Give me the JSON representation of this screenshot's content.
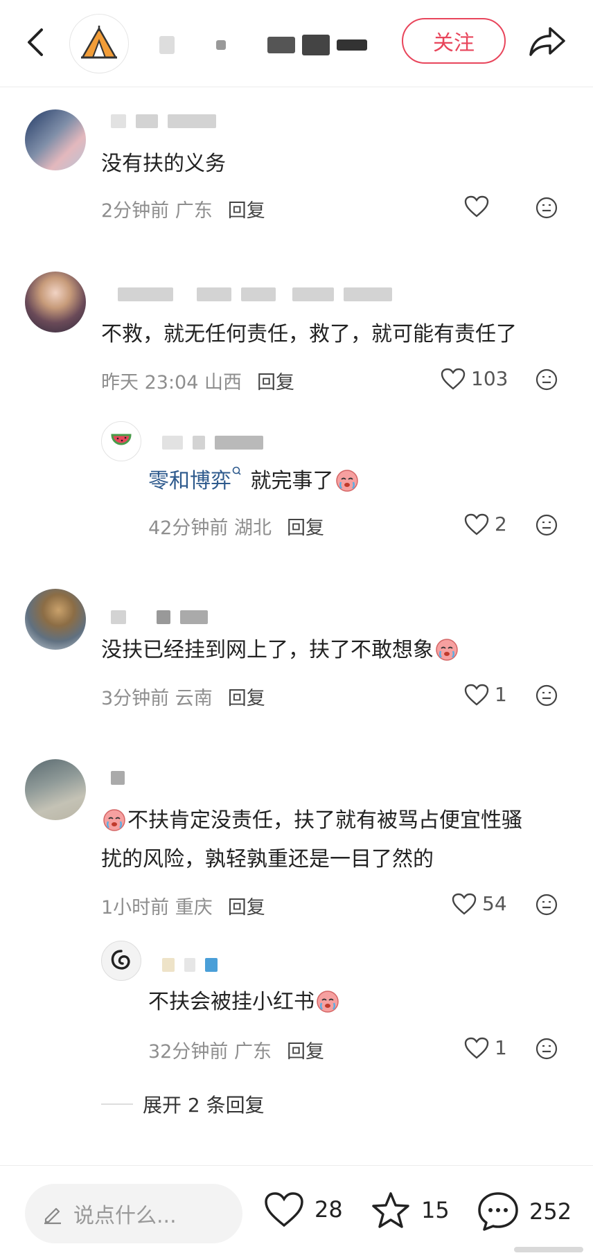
{
  "header": {
    "follow_label": "关注"
  },
  "comments": [
    {
      "text": "没有扶的义务",
      "time": "2分钟前",
      "location": "广东",
      "reply_label": "回复",
      "likes": ""
    },
    {
      "text": "不救，就无任何责任，救了，就可能有责任了",
      "time": "昨天 23:04",
      "location": "山西",
      "reply_label": "回复",
      "likes": "103"
    },
    {
      "mention": "零和博弈",
      "text": "就完事了",
      "time": "42分钟前",
      "location": "湖北",
      "reply_label": "回复",
      "likes": "2"
    },
    {
      "text": "没扶已经挂到网上了，扶了不敢想象",
      "time": "3分钟前",
      "location": "云南",
      "reply_label": "回复",
      "likes": "1"
    },
    {
      "text_line1": "不扶肯定没责任，扶了就有被骂占便宜性骚",
      "text_line2": "扰的风险，孰轻孰重还是一目了然的",
      "time": "1小时前",
      "location": "重庆",
      "reply_label": "回复",
      "likes": "54"
    },
    {
      "text": "不扶会被挂小红书",
      "time": "32分钟前",
      "location": "广东",
      "reply_label": "回复",
      "likes": "1"
    }
  ],
  "expand_label": "展开 2 条回复",
  "bottom_bar": {
    "input_placeholder": "说点什么...",
    "like_count": "28",
    "star_count": "15",
    "comment_count": "252"
  },
  "icons": {
    "back": "chevron-left-icon",
    "share": "share-arrow-icon",
    "heart": "heart-icon",
    "emoji": "neutral-face-icon",
    "star": "star-icon",
    "comment": "chat-bubble-icon",
    "pencil": "pencil-icon"
  },
  "colors": {
    "accent": "#e8455b",
    "mention": "#2e5a8d",
    "meta": "#8e8e8e"
  }
}
